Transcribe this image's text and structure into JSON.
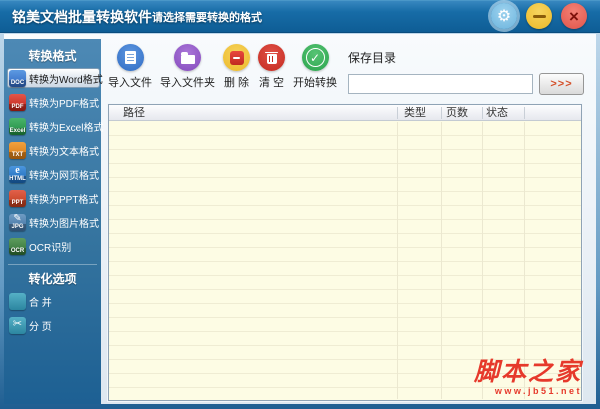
{
  "window": {
    "title": "铭美文档批量转换软件",
    "subtitle": "请选择需要转换的格式"
  },
  "icons": {
    "gear": "⚙",
    "minimize": "—",
    "close": "×",
    "check": "✓",
    "scissors": "✂",
    "pen": "✎",
    "html_e": "e"
  },
  "colors": {
    "titlebar": "#0e5d95",
    "sidebar_top": "#4d89b5",
    "sidebar_bottom": "#1d6093",
    "table_body": "#fdfce4",
    "selected_item": "#e3eaf1",
    "watermark_red": "#e6392b",
    "browse_text": "#d4502a"
  },
  "sidebar": {
    "section_format": {
      "title": "转换格式",
      "items": [
        {
          "label": "转换为Word格式",
          "badge": "DOC",
          "color": "#2f66c0",
          "selected": true
        },
        {
          "label": "转换为PDF格式",
          "badge": "PDF",
          "color": "#bc2015",
          "selected": false
        },
        {
          "label": "转换为Excel格式",
          "badge": "Excel",
          "color": "#1f8a40",
          "selected": false
        },
        {
          "label": "转换为文本格式",
          "badge": "TXT",
          "color": "#d57711",
          "selected": false
        },
        {
          "label": "转换为网页格式",
          "badge": "HTML",
          "color": "#1866b5",
          "selected": false
        },
        {
          "label": "转换为PPT格式",
          "badge": "PPT",
          "color": "#bb3a1a",
          "selected": false
        },
        {
          "label": "转换为图片格式",
          "badge": "JPG",
          "color": "#3f6f9e",
          "selected": false
        },
        {
          "label": "OCR识别",
          "badge": "OCR",
          "color": "#2f6e34",
          "selected": false
        }
      ]
    },
    "section_options": {
      "title": "转化选项",
      "items": [
        {
          "label": "合 并",
          "color": "#2c86a0"
        },
        {
          "label": "分 页",
          "color": "#2c86a0"
        }
      ]
    }
  },
  "toolbar": {
    "buttons": [
      {
        "label": "导入文件",
        "color": "#2f6cc4"
      },
      {
        "label": "导入文件夹",
        "color": "#8449bd"
      },
      {
        "label": "删 除",
        "color": "#ecb928"
      },
      {
        "label": "清 空",
        "color": "#c42a20"
      },
      {
        "label": "开始转换",
        "color": "#2aa44c"
      }
    ]
  },
  "save_dir": {
    "label": "保存目录",
    "input_value": "",
    "browse_label": ">>>"
  },
  "table": {
    "columns": [
      "路径",
      "类型",
      "页数",
      "状态"
    ],
    "rows": []
  },
  "watermark": {
    "line1": "脚本之家",
    "line2": "www.jb51.net"
  }
}
